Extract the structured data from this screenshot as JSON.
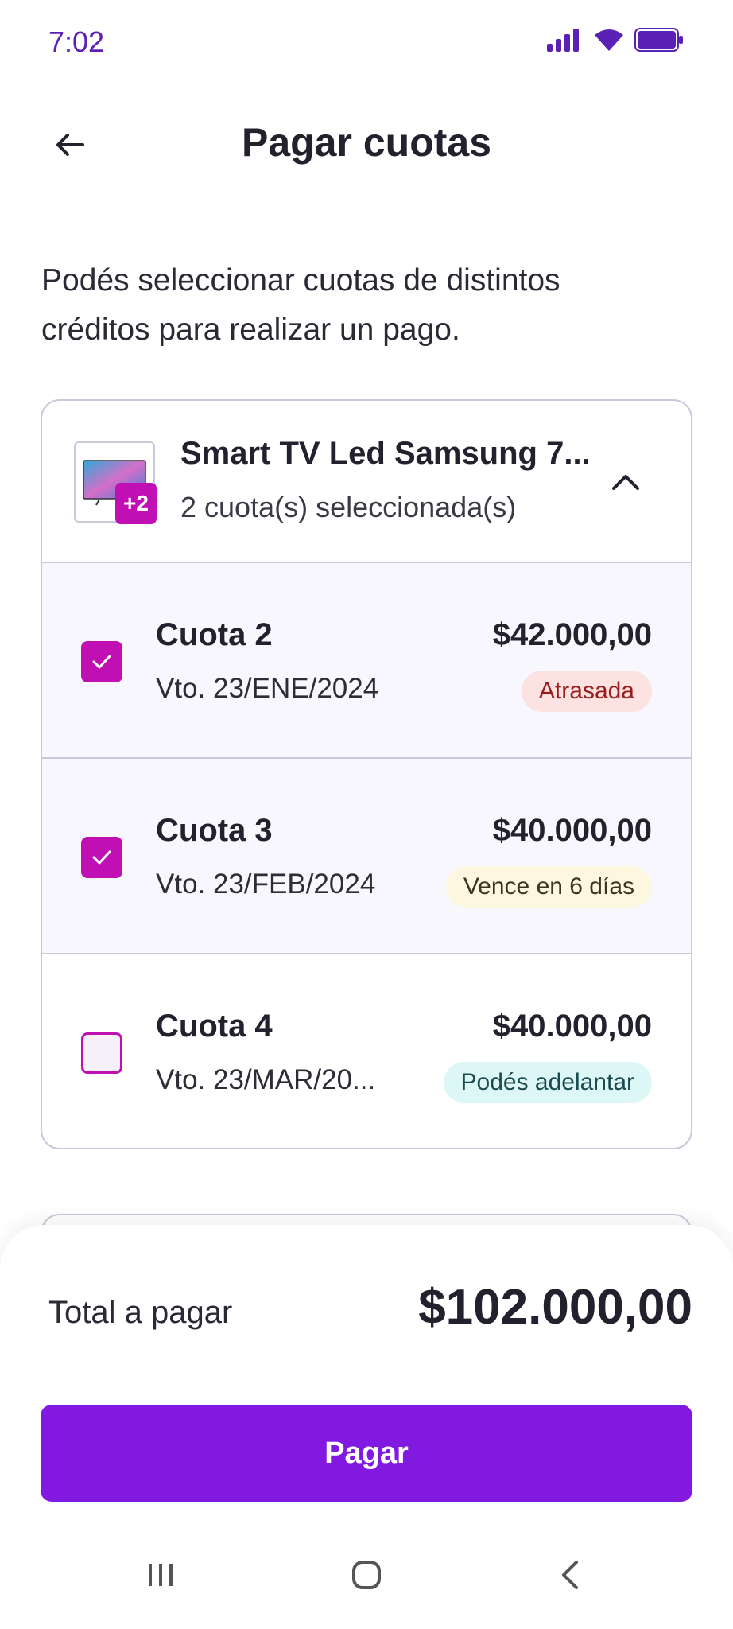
{
  "status_bar": {
    "time": "7:02"
  },
  "header": {
    "title": "Pagar cuotas"
  },
  "intro_text": "Podés seleccionar cuotas de distintos créditos para realizar un pago.",
  "credit": {
    "product_name": "Smart TV Led Samsung 7...",
    "extra_badge": "+2",
    "selected_summary": "2 cuota(s) seleccionada(s)",
    "installments": [
      {
        "title": "Cuota 2",
        "due": "Vto. 23/ENE/2024",
        "amount": "$42.000,00",
        "status": "Atrasada",
        "checked": true
      },
      {
        "title": "Cuota 3",
        "due": "Vto. 23/FEB/2024",
        "amount": "$40.000,00",
        "status": "Vence en 6 días",
        "checked": true
      },
      {
        "title": "Cuota 4",
        "due": "Vto. 23/MAR/20...",
        "amount": "$40.000,00",
        "status": "Podés adelantar",
        "checked": false
      }
    ]
  },
  "footer": {
    "total_label": "Total a pagar",
    "total_amount": "$102.000,00",
    "pay_label": "Pagar"
  },
  "colors": {
    "accent": "#c00fb2",
    "primary": "#8219e1",
    "status_text": "#5b21b6"
  },
  "icons": [
    "signal-icon",
    "wifi-icon",
    "battery-icon",
    "back-arrow-icon",
    "chevron-up-icon",
    "check-icon",
    "recents-icon",
    "home-icon",
    "nav-back-icon"
  ]
}
